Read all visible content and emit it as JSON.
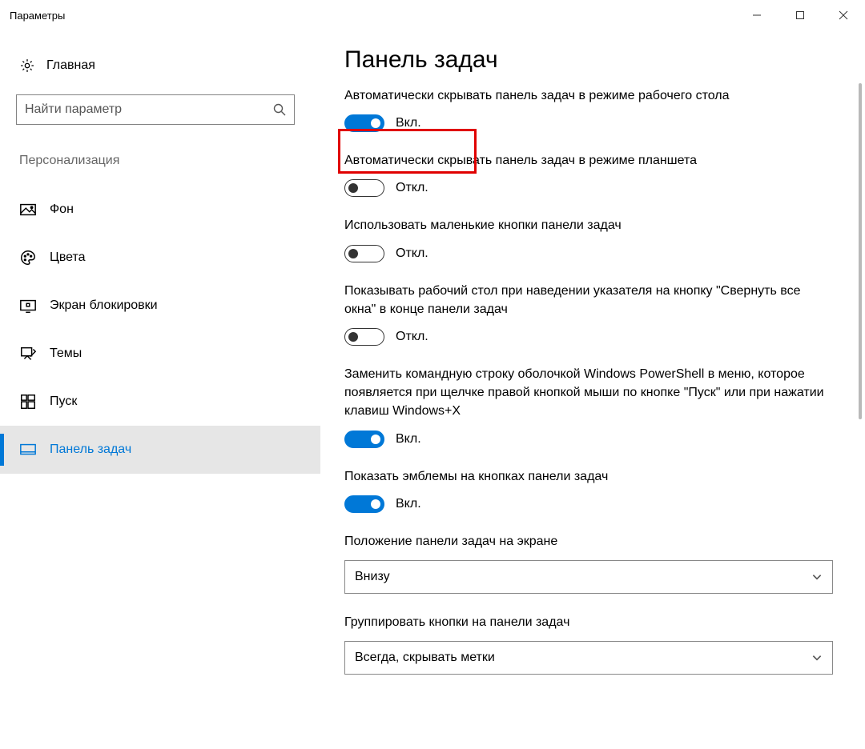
{
  "window": {
    "title": "Параметры"
  },
  "sidebar": {
    "home": "Главная",
    "searchPlaceholder": "Найти параметр",
    "section": "Персонализация",
    "items": [
      {
        "label": "Фон"
      },
      {
        "label": "Цвета"
      },
      {
        "label": "Экран блокировки"
      },
      {
        "label": "Темы"
      },
      {
        "label": "Пуск"
      },
      {
        "label": "Панель задач"
      }
    ]
  },
  "main": {
    "title": "Панель задач",
    "stateOn": "Вкл.",
    "stateOff": "Откл.",
    "settings": [
      {
        "label": "Автоматически скрывать панель задач в режиме рабочего стола",
        "on": true
      },
      {
        "label": "Автоматически скрывать панель задач в режиме планшета",
        "on": false
      },
      {
        "label": "Использовать маленькие кнопки панели задач",
        "on": false
      },
      {
        "label": "Показывать рабочий стол при наведении указателя на кнопку \"Свернуть все окна\" в конце панели задач",
        "on": false
      },
      {
        "label": "Заменить командную строку оболочкой Windows PowerShell в меню, которое появляется при щелчке правой кнопкой мыши по кнопке \"Пуск\" или при нажатии клавиш Windows+X",
        "on": true
      },
      {
        "label": "Показать эмблемы на кнопках панели задач",
        "on": true
      }
    ],
    "positionLabel": "Положение панели задач на экране",
    "positionValue": "Внизу",
    "groupLabel": "Группировать кнопки на панели задач",
    "groupValue": "Всегда, скрывать метки"
  }
}
